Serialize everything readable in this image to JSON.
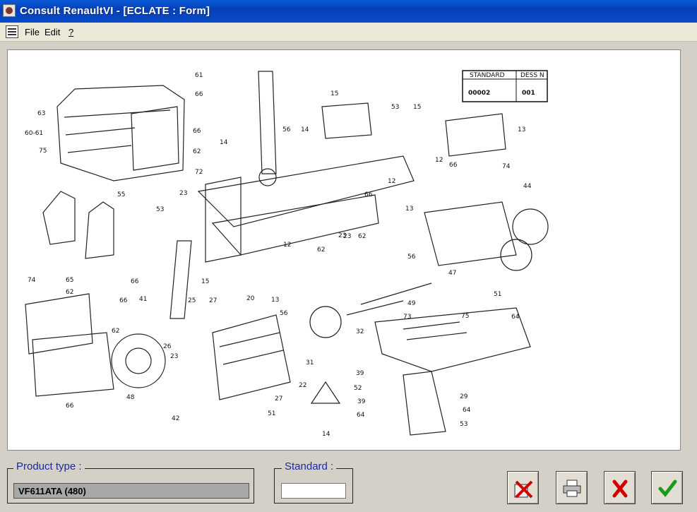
{
  "window": {
    "title": "Consult RenaultVI - [ECLATE : Form]",
    "app_icon": "app-icon"
  },
  "menu": {
    "file": "File",
    "edit": "Edit",
    "help": "?"
  },
  "drawing": {
    "standard_header": "STANDARD",
    "sheet_header": "DESS N",
    "standard_value": "00002",
    "sheet_value": "001",
    "labels": [
      "61",
      "66",
      "63",
      "60-61",
      "66",
      "75",
      "62",
      "14",
      "72",
      "23",
      "56",
      "14",
      "15",
      "53",
      "15",
      "13",
      "12",
      "66",
      "74",
      "44",
      "55",
      "23",
      "12",
      "66",
      "53",
      "13",
      "23",
      "62",
      "12",
      "62",
      "56",
      "47",
      "74",
      "65",
      "66",
      "15",
      "41",
      "20",
      "13",
      "56",
      "51",
      "62",
      "66",
      "25",
      "27",
      "49",
      "32",
      "73",
      "75",
      "64",
      "62",
      "26",
      "23",
      "31",
      "39",
      "52",
      "29",
      "39",
      "64",
      "64",
      "53",
      "48",
      "42",
      "27",
      "22",
      "51",
      "14",
      "66"
    ]
  },
  "product_type": {
    "label": "Product type :",
    "value": "VF611ATA (480)"
  },
  "standard": {
    "label": "Standard :",
    "value": ""
  },
  "buttons": {
    "clear": "clear-icon",
    "print": "printer-icon",
    "cancel": "cancel-icon",
    "ok": "check-icon"
  }
}
